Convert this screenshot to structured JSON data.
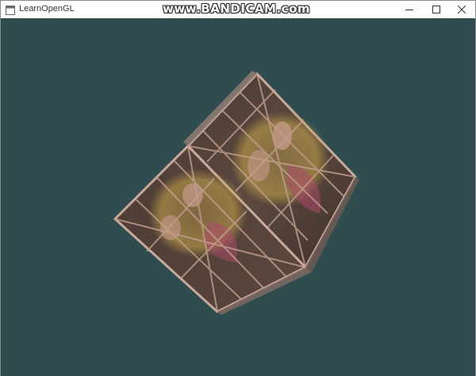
{
  "window": {
    "title": "LearnOpenGL",
    "icon": "app-window-icon",
    "controls": {
      "minimize": "minimize-icon",
      "maximize": "maximize-icon",
      "close": "close-icon"
    }
  },
  "watermark": {
    "text": "www.BANDICAM.com"
  },
  "scene": {
    "clear_color": "#2f4d4f",
    "object": "textured-cube",
    "textures": [
      "wooden-crate",
      "awesome-face"
    ]
  }
}
